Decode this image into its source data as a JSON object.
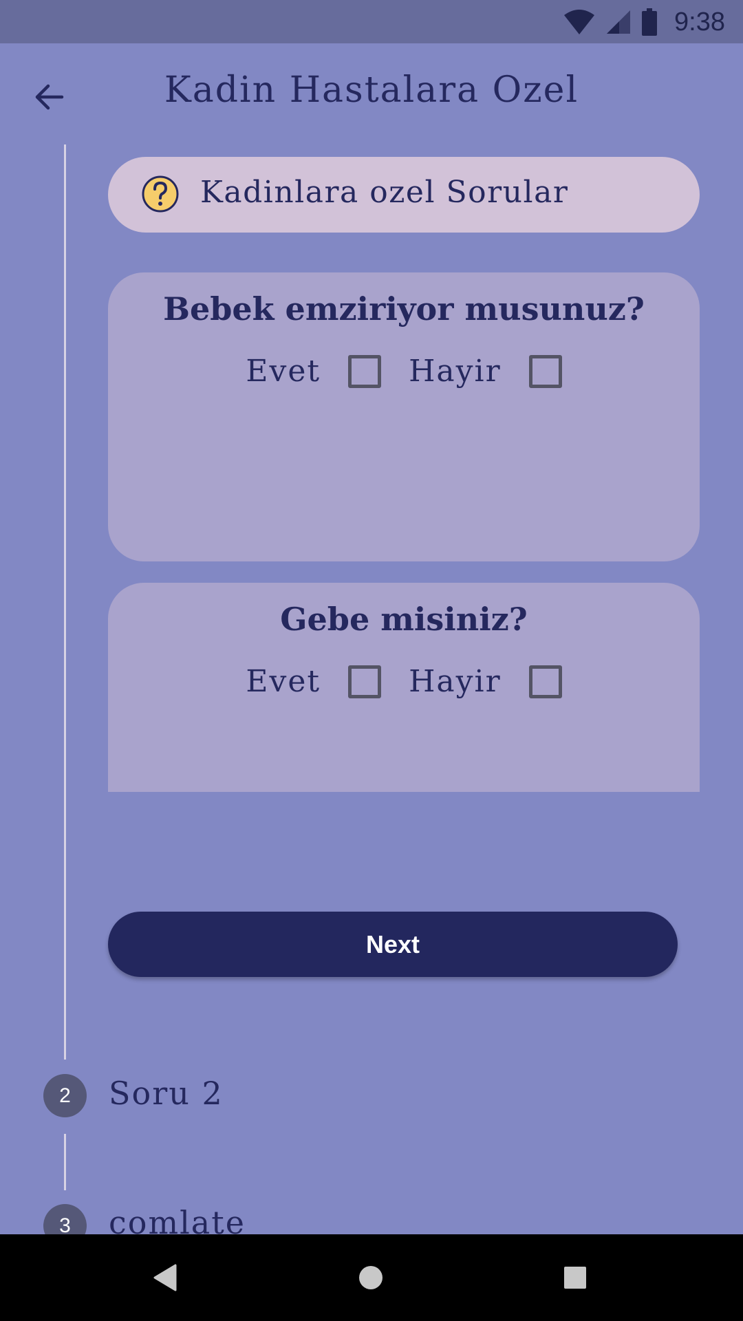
{
  "status_bar": {
    "time": "9:38",
    "icons": [
      "wifi-icon",
      "cell-signal-icon",
      "battery-icon"
    ]
  },
  "app_bar": {
    "title": "Kadin Hastalara Ozel",
    "back_icon": "arrow-back-icon"
  },
  "stepper": {
    "active_step": {
      "label": "Kadinlara ozel Sorular",
      "icon": "help-circle-icon"
    },
    "questions": [
      {
        "text": "Bebek emziriyor musunuz?",
        "options": [
          "Evet",
          "Hayir"
        ],
        "checked": [
          false,
          false
        ]
      },
      {
        "text": "Gebe misiniz?",
        "options": [
          "Evet",
          "Hayir"
        ],
        "checked": [
          false,
          false
        ]
      }
    ],
    "next_label": "Next",
    "steps": [
      {
        "number": "2",
        "label": "Soru 2"
      },
      {
        "number": "3",
        "label": "comlate"
      }
    ]
  },
  "nav_bar": {
    "icons": [
      "back-triangle-icon",
      "home-circle-icon",
      "recents-square-icon"
    ]
  },
  "colors": {
    "background": "#8288c4",
    "status_bar": "#676c9c",
    "header_pill": "#d2c2d8",
    "card": "#a9a3cc",
    "primary": "#23275e",
    "help_icon": "#f6cd6b"
  }
}
